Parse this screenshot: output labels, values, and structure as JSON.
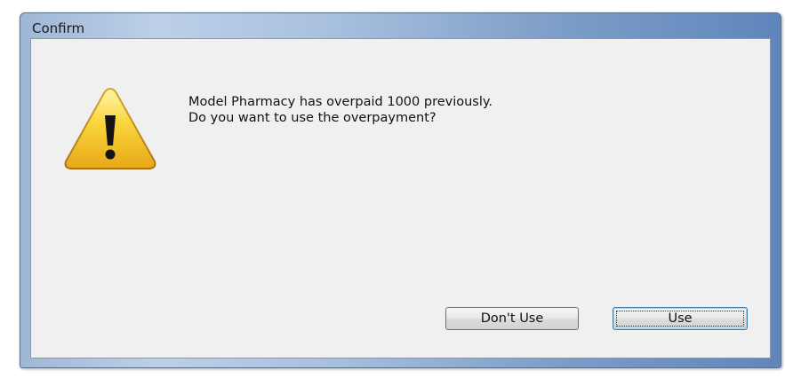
{
  "dialog": {
    "title": "Confirm",
    "icon": "warning-icon",
    "message_line1": "Model Pharmacy has overpaid 1000 previously.",
    "message_line2": "Do you want to use the overpayment?",
    "buttons": {
      "dont_use_label": "Don't Use",
      "use_label": "Use"
    }
  },
  "colors": {
    "warning_yellow": "#f5c518",
    "client_background": "#f0f0f0",
    "default_button_border": "#3c7fb1"
  }
}
